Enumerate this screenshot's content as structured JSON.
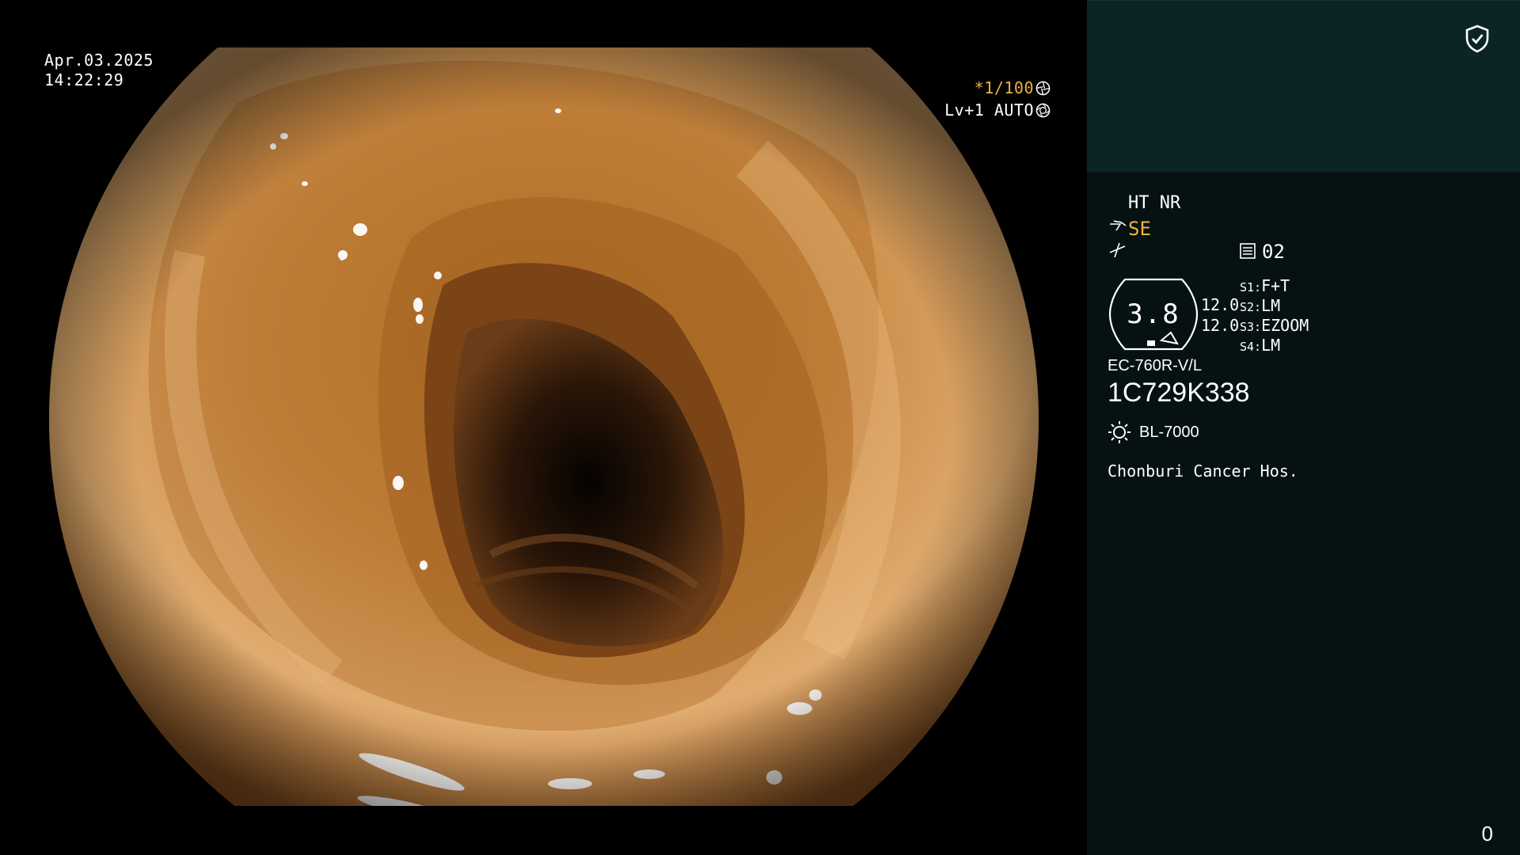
{
  "video": {
    "date": "Apr.03.2025",
    "time": "14:22:29",
    "shutter": "*1/100",
    "level": "Lv+1 AUTO"
  },
  "panel": {
    "modes": "HT NR",
    "enhancement": "SE",
    "monitor_number": "02",
    "gauge_value": "3.8",
    "value_1": "12.0",
    "value_2": "12.0",
    "switches": [
      {
        "label": "S1:",
        "value": "F+T"
      },
      {
        "label": "S2:",
        "value": "LM"
      },
      {
        "label": "S3:",
        "value": "EZOOM"
      },
      {
        "label": "S4:",
        "value": "LM"
      }
    ],
    "scope_model": "EC-760R-V/L",
    "scope_serial": "1C729K338",
    "light_source": "BL-7000",
    "hospital": "Chonburi Cancer Hos.",
    "counter": "0"
  },
  "colors": {
    "accent": "#f0b040",
    "panel_top": "#0b2526",
    "panel_bg": "#061212"
  },
  "icons": [
    "shield-check-icon",
    "aperture-icon",
    "iris-icon",
    "se-wave-icon",
    "structure-icon",
    "monitor-icon",
    "gauge-icon",
    "light-source-icon"
  ]
}
